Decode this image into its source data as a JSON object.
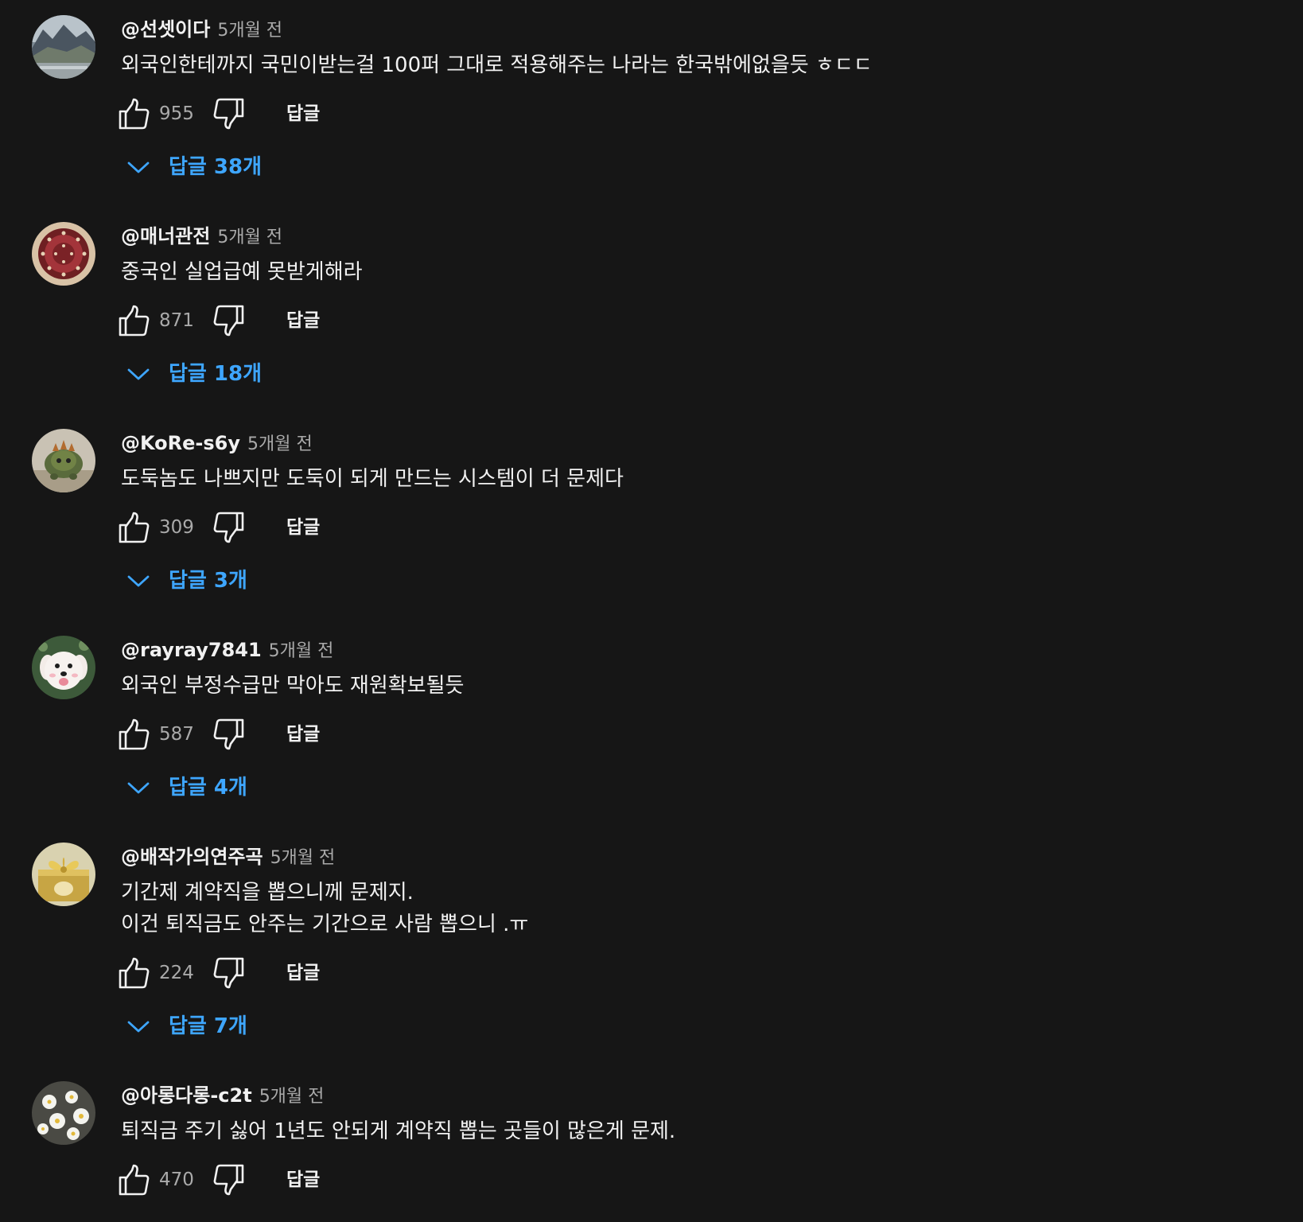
{
  "colors": {
    "background": "#161616",
    "text": "#f1f1f1",
    "secondary_text": "#aaaaaa",
    "link_blue": "#3ea6ff"
  },
  "reply_label": "답글",
  "comments": [
    {
      "author": "@선셋이다",
      "time": "5개월 전",
      "lines": [
        "외국인한테까지 국민이받는걸 100퍼 그대로 적용해주는 나라는 한국밖에없을듯 ㅎㄷㄷ"
      ],
      "likes": "955",
      "replies_label": "답글 38개",
      "avatar_icon": "mountain-landscape-avatar"
    },
    {
      "author": "@매너관전",
      "time": "5개월 전",
      "lines": [
        "중국인 실업급예 못받게해라"
      ],
      "likes": "871",
      "replies_label": "답글 18개",
      "avatar_icon": "red-pattern-avatar"
    },
    {
      "author": "@KoRe-s6y",
      "time": "5개월 전",
      "lines": [
        "도둑놈도 나쁘지만 도둑이 되게 만드는 시스템이 더 문제다"
      ],
      "likes": "309",
      "replies_label": "답글 3개",
      "avatar_icon": "creature-figure-avatar"
    },
    {
      "author": "@rayray7841",
      "time": "5개월 전",
      "lines": [
        "외국인 부정수급만 막아도 재원확보될듯"
      ],
      "likes": "587",
      "replies_label": "답글 4개",
      "avatar_icon": "white-puppy-avatar"
    },
    {
      "author": "@배작가의연주곡",
      "time": "5개월 전",
      "lines": [
        "기간제 계약직을 뽑으니께 문제지.",
        "이건 퇴직금도 안주는 기간으로 사람 뽑으니 .ㅠ"
      ],
      "likes": "224",
      "replies_label": "답글 7개",
      "avatar_icon": "gold-gift-box-avatar"
    },
    {
      "author": "@아롱다롱-c2t",
      "time": "5개월 전",
      "lines": [
        "퇴직금 주기 싫어 1년도 안되게 계약직 뽑는 곳들이 많은게 문제."
      ],
      "likes": "470",
      "replies_label": "",
      "avatar_icon": "white-flowers-avatar"
    }
  ]
}
